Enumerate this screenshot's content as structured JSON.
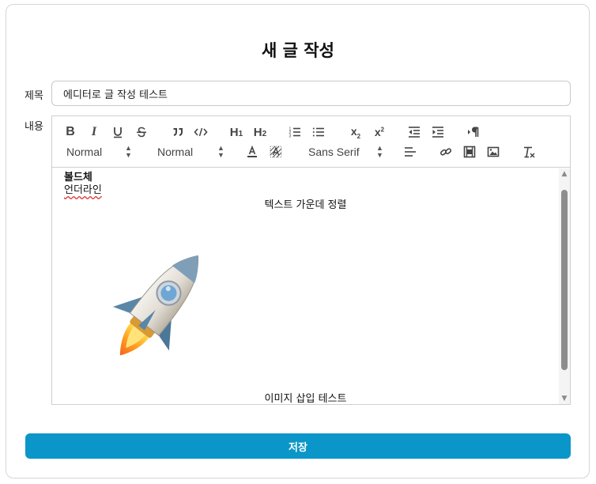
{
  "page": {
    "title": "새 글 작성"
  },
  "form": {
    "title_label": "제목",
    "title_value": "에디터로 글 작성 테스트",
    "content_label": "내용"
  },
  "toolbar": {
    "buttons": [
      "bold",
      "italic",
      "underline",
      "strike",
      "blockquote",
      "code-block",
      "header-1",
      "header-2",
      "ordered-list",
      "bullet-list",
      "subscript",
      "superscript",
      "outdent",
      "indent",
      "text-direction-rtl",
      "align",
      "link",
      "video",
      "image",
      "clean"
    ],
    "header_picker": "Normal",
    "size_picker": "Normal",
    "font_picker": "Sans Serif",
    "labels": {
      "h1": "H",
      "h1_sub": "1",
      "h2": "H",
      "h2_sub": "2",
      "sub": "x",
      "sub_sub": "2",
      "sup": "x",
      "sup_sup": "2"
    }
  },
  "editor": {
    "lines": {
      "bold": "볼드체",
      "underline": "언더라인",
      "center": "텍스트 가운데 정렬",
      "caption": "이미지 삽입 테스트"
    },
    "image": "rocket-image"
  },
  "actions": {
    "save": "저장"
  },
  "colors": {
    "accent": "#0a96c8",
    "border": "#cfcfcf"
  }
}
